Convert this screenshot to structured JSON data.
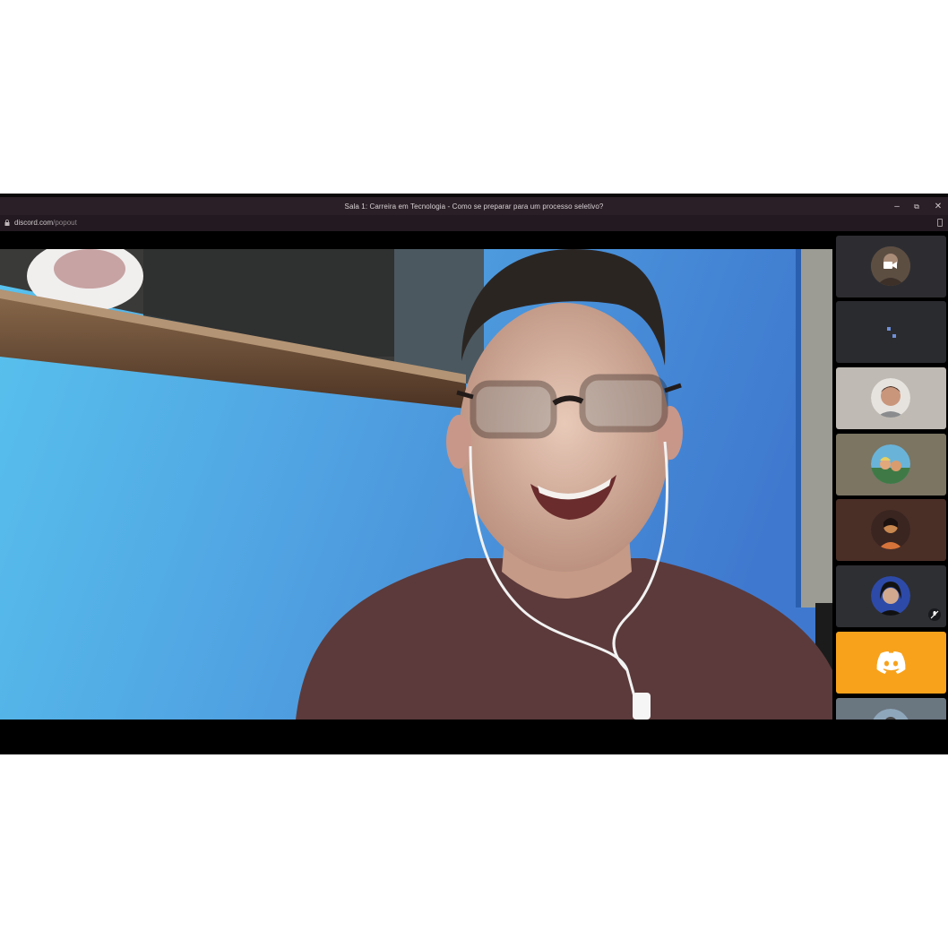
{
  "window": {
    "title": "Sala 1: Carreira em Tecnologia - Como se preparar para um processo seletivo?",
    "minimize_glyph": "–",
    "maximize_glyph": "⧉",
    "close_glyph": "✕"
  },
  "address_bar": {
    "domain": "discord.com",
    "path": "/popout",
    "lock_icon": "lock-icon",
    "extension_icon": "extension-icon"
  },
  "main_video": {
    "description_icon": "participant-video-feed"
  },
  "participants": [
    {
      "kind": "video-camera",
      "bg": "#2d2d31"
    },
    {
      "kind": "loading",
      "bg": "#2a2b2f"
    },
    {
      "kind": "avatar",
      "bg": "#bfbab3"
    },
    {
      "kind": "avatar",
      "bg": "#7b7562"
    },
    {
      "kind": "avatar",
      "bg": "#4a2f27"
    },
    {
      "kind": "avatar-muted",
      "bg": "#2e2f33"
    },
    {
      "kind": "discord-logo",
      "bg": "#f8a21b"
    },
    {
      "kind": "avatar",
      "bg": "#6a7680"
    }
  ],
  "colors": {
    "titlebar": "#2a1f26",
    "discord_tile": "#f8a21b",
    "wall_blue": "#4a9bdc"
  }
}
